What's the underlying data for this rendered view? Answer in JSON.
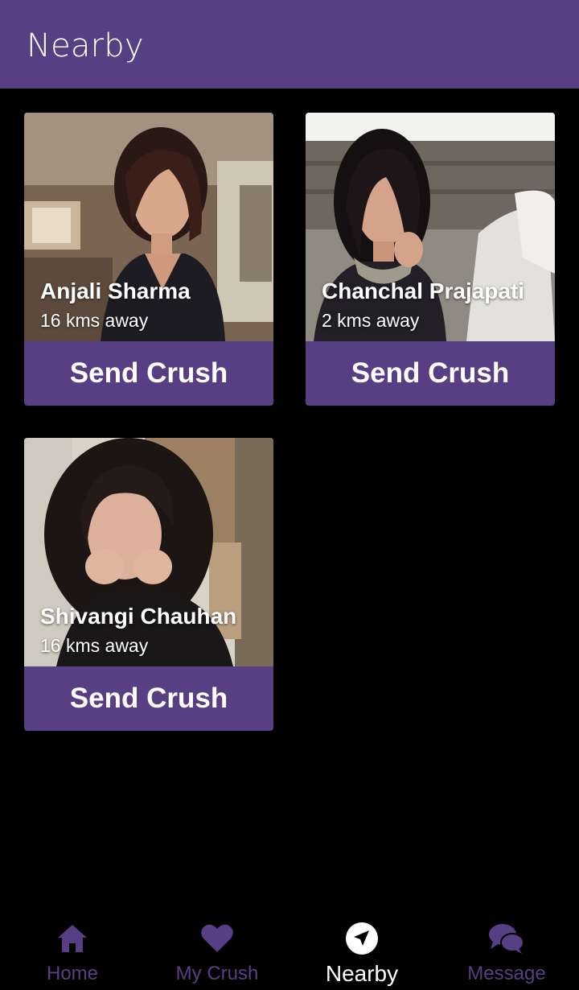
{
  "header": {
    "title": "Nearby"
  },
  "cards": [
    {
      "name": "Anjali Sharma",
      "distance": "16 kms away",
      "button": "Send Crush"
    },
    {
      "name": "Chanchal Prajapati",
      "distance": "2 kms away",
      "button": "Send Crush"
    },
    {
      "name": "Shivangi Chauhan",
      "distance": "16 kms away",
      "button": "Send Crush"
    }
  ],
  "nav": [
    {
      "label": "Home",
      "icon": "home-icon"
    },
    {
      "label": "My Crush",
      "icon": "heart-icon"
    },
    {
      "label": "Nearby",
      "icon": "navigation-arrow-icon",
      "active": true
    },
    {
      "label": "Message",
      "icon": "chat-bubbles-icon"
    }
  ],
  "colors": {
    "accent": "#583f84",
    "background": "#000000",
    "text": "#ffffff"
  }
}
